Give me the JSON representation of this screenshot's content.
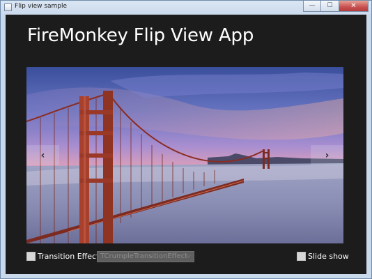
{
  "window": {
    "title": "Flip view sample",
    "minimize_glyph": "—",
    "maximize_glyph": "☐",
    "close_glyph": "✕"
  },
  "app": {
    "heading": "FireMonkey Flip View App"
  },
  "flipview": {
    "image_subject": "golden-gate-bridge-photo",
    "prev_glyph": "‹",
    "next_glyph": "›"
  },
  "controls": {
    "transition_checkbox_checked": false,
    "transition_label": "Transition Effect",
    "transition_combo_value": "TCrumpleTransitionEffect",
    "combo_arrow_glyph": "⌵",
    "slideshow_checkbox_checked": false,
    "slideshow_label": "Slide show"
  },
  "colors": {
    "client_background": "#1c1c1c",
    "heading_text": "#ffffff",
    "close_button": "#c75050"
  }
}
